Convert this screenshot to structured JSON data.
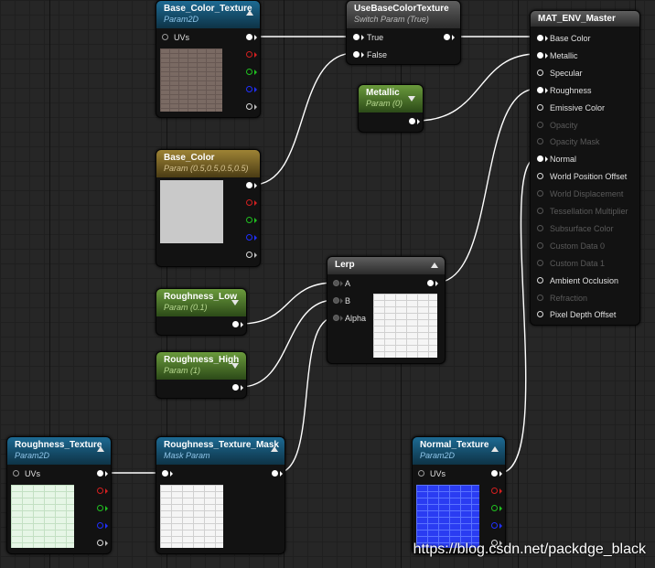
{
  "nodes": {
    "base_color_texture": {
      "title": "Base_Color_Texture",
      "subtitle": "Param2D",
      "uvs": "UVs"
    },
    "use_base_color_texture": {
      "title": "UseBaseColorTexture",
      "subtitle": "Switch Param (True)",
      "true_label": "True",
      "false_label": "False"
    },
    "metallic": {
      "title": "Metallic",
      "subtitle": "Param (0)"
    },
    "base_color": {
      "title": "Base_Color",
      "subtitle": "Param (0.5,0.5,0.5,0.5)"
    },
    "lerp": {
      "title": "Lerp",
      "a": "A",
      "b": "B",
      "alpha": "Alpha"
    },
    "roughness_low": {
      "title": "Roughness_Low",
      "subtitle": "Param (0.1)"
    },
    "roughness_high": {
      "title": "Roughness_High",
      "subtitle": "Param (1)"
    },
    "roughness_texture": {
      "title": "Roughness_Texture",
      "subtitle": "Param2D",
      "uvs": "UVs"
    },
    "roughness_texture_mask": {
      "title": "Roughness_Texture_Mask",
      "subtitle": "Mask Param"
    },
    "normal_texture": {
      "title": "Normal_Texture",
      "subtitle": "Param2D",
      "uvs": "UVs"
    },
    "material": {
      "title": "MAT_ENV_Master",
      "pins": [
        "Base Color",
        "Metallic",
        "Specular",
        "Roughness",
        "Emissive Color",
        "Opacity",
        "Opacity Mask",
        "Normal",
        "World Position Offset",
        "World Displacement",
        "Tessellation Multiplier",
        "Subsurface Color",
        "Custom Data 0",
        "Custom Data 1",
        "Ambient Occlusion",
        "Refraction",
        "Pixel Depth Offset"
      ]
    }
  },
  "watermark": "https://blog.csdn.net/packdge_black",
  "colors": {
    "param_header": "#1d6a93",
    "scalar_header": "#6a9a3c",
    "vector_header": "#9e8335",
    "result_header": "#5f5f5f",
    "wire": "#ffffff"
  }
}
